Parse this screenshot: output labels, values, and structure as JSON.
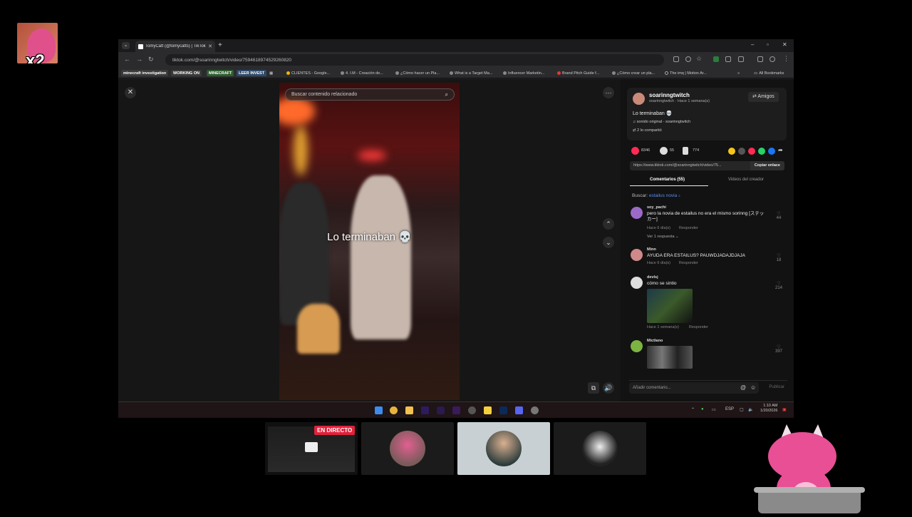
{
  "overlay": {
    "multiplier": "x2",
    "live_label": "EN DIRECTO"
  },
  "browser": {
    "tab_title": "TomyCatt (@tomycatts) | TikTok",
    "url": "tiktok.com/@soarinngtwitch/video/7594618974529260820",
    "bookmarks_tags": [
      "minecraft investigation",
      "WORKING ON",
      "MINECRAFT",
      "LEER INVEST"
    ],
    "bookmarks": [
      "CLIENTES - Google...",
      "4. I.M - Creación de...",
      "¿Cómo hacer un Pla...",
      "What is a Target Ma...",
      "Influencer Marketin...",
      "Brand Pitch Guide f...",
      "¿Cómo crear un pla...",
      "The imq | Motion Ar..."
    ],
    "all_bookmarks": "All Bookmarks"
  },
  "video": {
    "search_placeholder": "Buscar contenido relacionado",
    "caption": "Lo terminaban 💀"
  },
  "author": {
    "name": "soarinngtwitch",
    "sub": "soarinngtwitch · Hace 1 semana(s)",
    "follow_label": "⇄ Amigos",
    "description": "Lo terminaban 💀",
    "sound": "♫ sonido original - soarinngtwitch",
    "shared": "2 lo compartió"
  },
  "stats": {
    "likes": "8346",
    "comments": "55",
    "saves": "774"
  },
  "link": {
    "url": "https://www.tiktok.com/@soarinngtwitch/video/75...",
    "copy_label": "Copiar enlace"
  },
  "tabs": {
    "comments": "Comentarios (55)",
    "creator_videos": "Videos del creador"
  },
  "search_hint": {
    "label": "Buscar:",
    "term": "estailus novia"
  },
  "comments": [
    {
      "user": "soy_pachi",
      "text": "pero la novia de estailus no era el mismo sorinng [ステッカー]",
      "meta": "Hace 6 día(s)",
      "reply": "Responder",
      "likes": "44",
      "replies": "Ver 1 respuesta ⌄"
    },
    {
      "user": "Minn",
      "text": "AYUDA ERA ESTAILUS? PAUWDJADAJDJAJA",
      "meta": "Hace 6 día(s)",
      "reply": "Responder",
      "likes": "18"
    },
    {
      "user": "devlsj",
      "text": "cómo se sintio",
      "meta": "Hace 1 semana(s)",
      "reply": "Responder",
      "likes": "214"
    },
    {
      "user": "Mictlano",
      "text": "",
      "likes": "397"
    }
  ],
  "comment_input": {
    "placeholder": "Añadir comentario...",
    "publish": "Publicar"
  },
  "taskbar": {
    "lang": "ESP",
    "time": "1:10 AM",
    "date": "1/20/2026"
  },
  "colors": {
    "accent": "#fe2c55",
    "live": "#e0223c",
    "link": "#5b8def"
  }
}
